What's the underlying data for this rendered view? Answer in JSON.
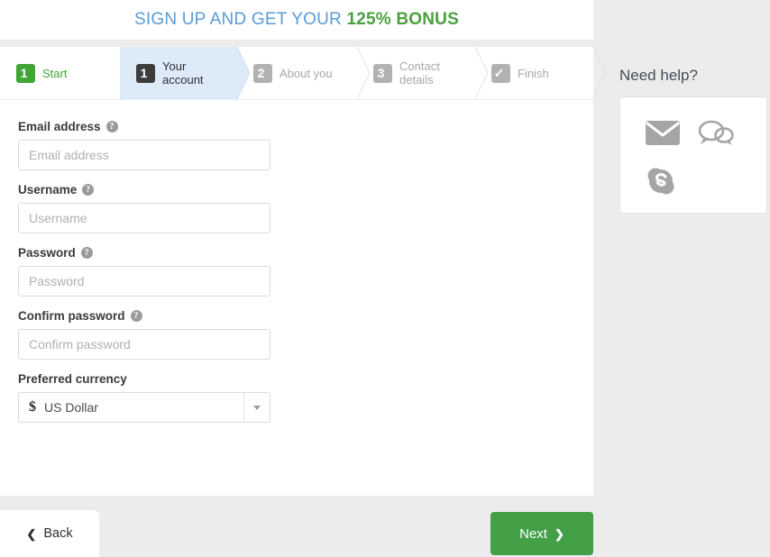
{
  "promo": {
    "lead": "SIGN UP AND GET YOUR ",
    "bonus": "125% BONUS",
    "lead_color": "#5b9bd5",
    "bonus_color": "#4aa03f"
  },
  "steps": [
    {
      "badge": "1",
      "label_line1": "Start",
      "label_line2": "",
      "state": "done",
      "badge_color": "#3fa535",
      "label_color": "#3fa535"
    },
    {
      "badge": "1",
      "label_line1": "Your",
      "label_line2": "account",
      "state": "active",
      "badge_color": "#3c3c3c",
      "label_color": "#2f2f2f"
    },
    {
      "badge": "2",
      "label_line1": "About you",
      "label_line2": "",
      "state": "pending",
      "badge_color": "#b2b2b2",
      "label_color": "#a8a8a8"
    },
    {
      "badge": "3",
      "label_line1": "Contact",
      "label_line2": "details",
      "state": "pending",
      "badge_color": "#b2b2b2",
      "label_color": "#a8a8a8"
    },
    {
      "badge": "✓",
      "label_line1": "Finish",
      "label_line2": "",
      "state": "pending",
      "badge_color": "#b2b2b2",
      "label_color": "#a8a8a8"
    }
  ],
  "form": {
    "fields": [
      {
        "label": "Email address",
        "help": "?",
        "placeholder": "Email address",
        "value": ""
      },
      {
        "label": "Username",
        "help": "?",
        "placeholder": "Username",
        "value": ""
      },
      {
        "label": "Password",
        "help": "?",
        "placeholder": "Password",
        "value": ""
      },
      {
        "label": "Confirm password",
        "help": "?",
        "placeholder": "Confirm password",
        "value": ""
      }
    ],
    "currency": {
      "label": "Preferred currency",
      "symbol": "$",
      "selected": "US Dollar",
      "caret": "caret-down-icon"
    }
  },
  "buttons": {
    "back_label": "Back",
    "back_arrow": "❮",
    "next_label": "Next",
    "next_arrow": "❯",
    "next_color": "#43a047"
  },
  "help": {
    "heading": "Need help?",
    "icons": [
      {
        "name": "email-icon"
      },
      {
        "name": "chat-icon"
      },
      {
        "name": "skype-icon"
      }
    ]
  }
}
